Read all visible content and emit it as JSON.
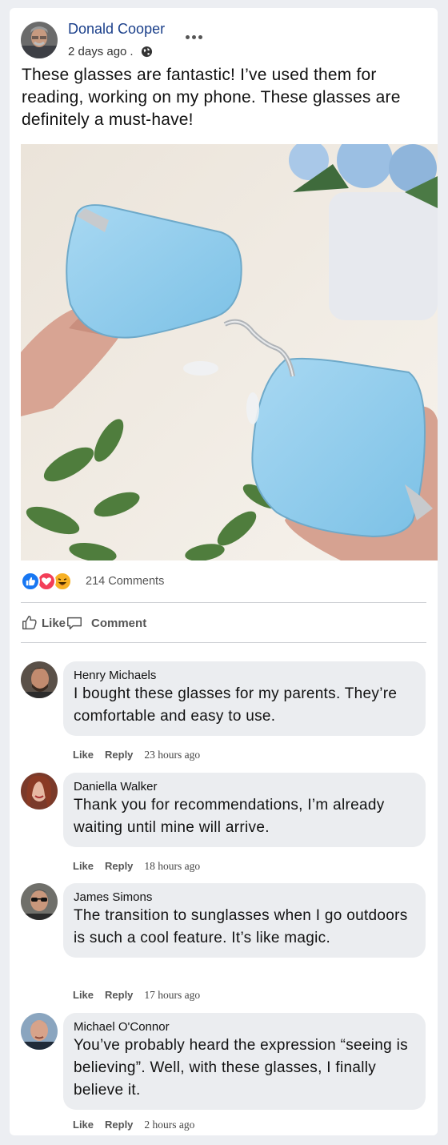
{
  "post": {
    "author": "Donald Cooper",
    "time": "2 days ago",
    "time_separator": ".",
    "text": "These glasses are fantastic! I’ve used them for reading, working on my phone. These glasses are definitely a must-have!",
    "comment_count": "214 Comments",
    "reactions": [
      "like-icon",
      "love-icon",
      "haha-icon"
    ]
  },
  "actions": {
    "like": "Like",
    "comment": "Comment"
  },
  "comments": [
    {
      "name": "Henry Michaels",
      "text": "I bought these glasses for my parents. They’re comfortable and easy to use.",
      "like": "Like",
      "reply": "Reply",
      "time": "23 hours ago"
    },
    {
      "name": "Daniella Walker",
      "text": "Thank you for recommendations, I’m already waiting until mine will arrive.",
      "like": "Like",
      "reply": "Reply",
      "time": "18 hours ago"
    },
    {
      "name": "James Simons",
      "text": "The transition to sunglasses when I go outdoors is such a cool feature. It’s like magic.",
      "like": "Like",
      "reply": "Reply",
      "time": "17 hours ago"
    },
    {
      "name": "Michael O'Connor",
      "text": "You’ve probably heard the expression “seeing is believing”. Well, with these glasses, I finally believe it.",
      "like": "Like",
      "reply": "Reply",
      "time": "2 hours ago"
    }
  ],
  "colors": {
    "name_blue": "#1a3f8a",
    "like_blue": "#1877f2",
    "love_red": "#f33e58",
    "haha_yellow": "#f7b125",
    "bubble": "#ebedf0"
  }
}
